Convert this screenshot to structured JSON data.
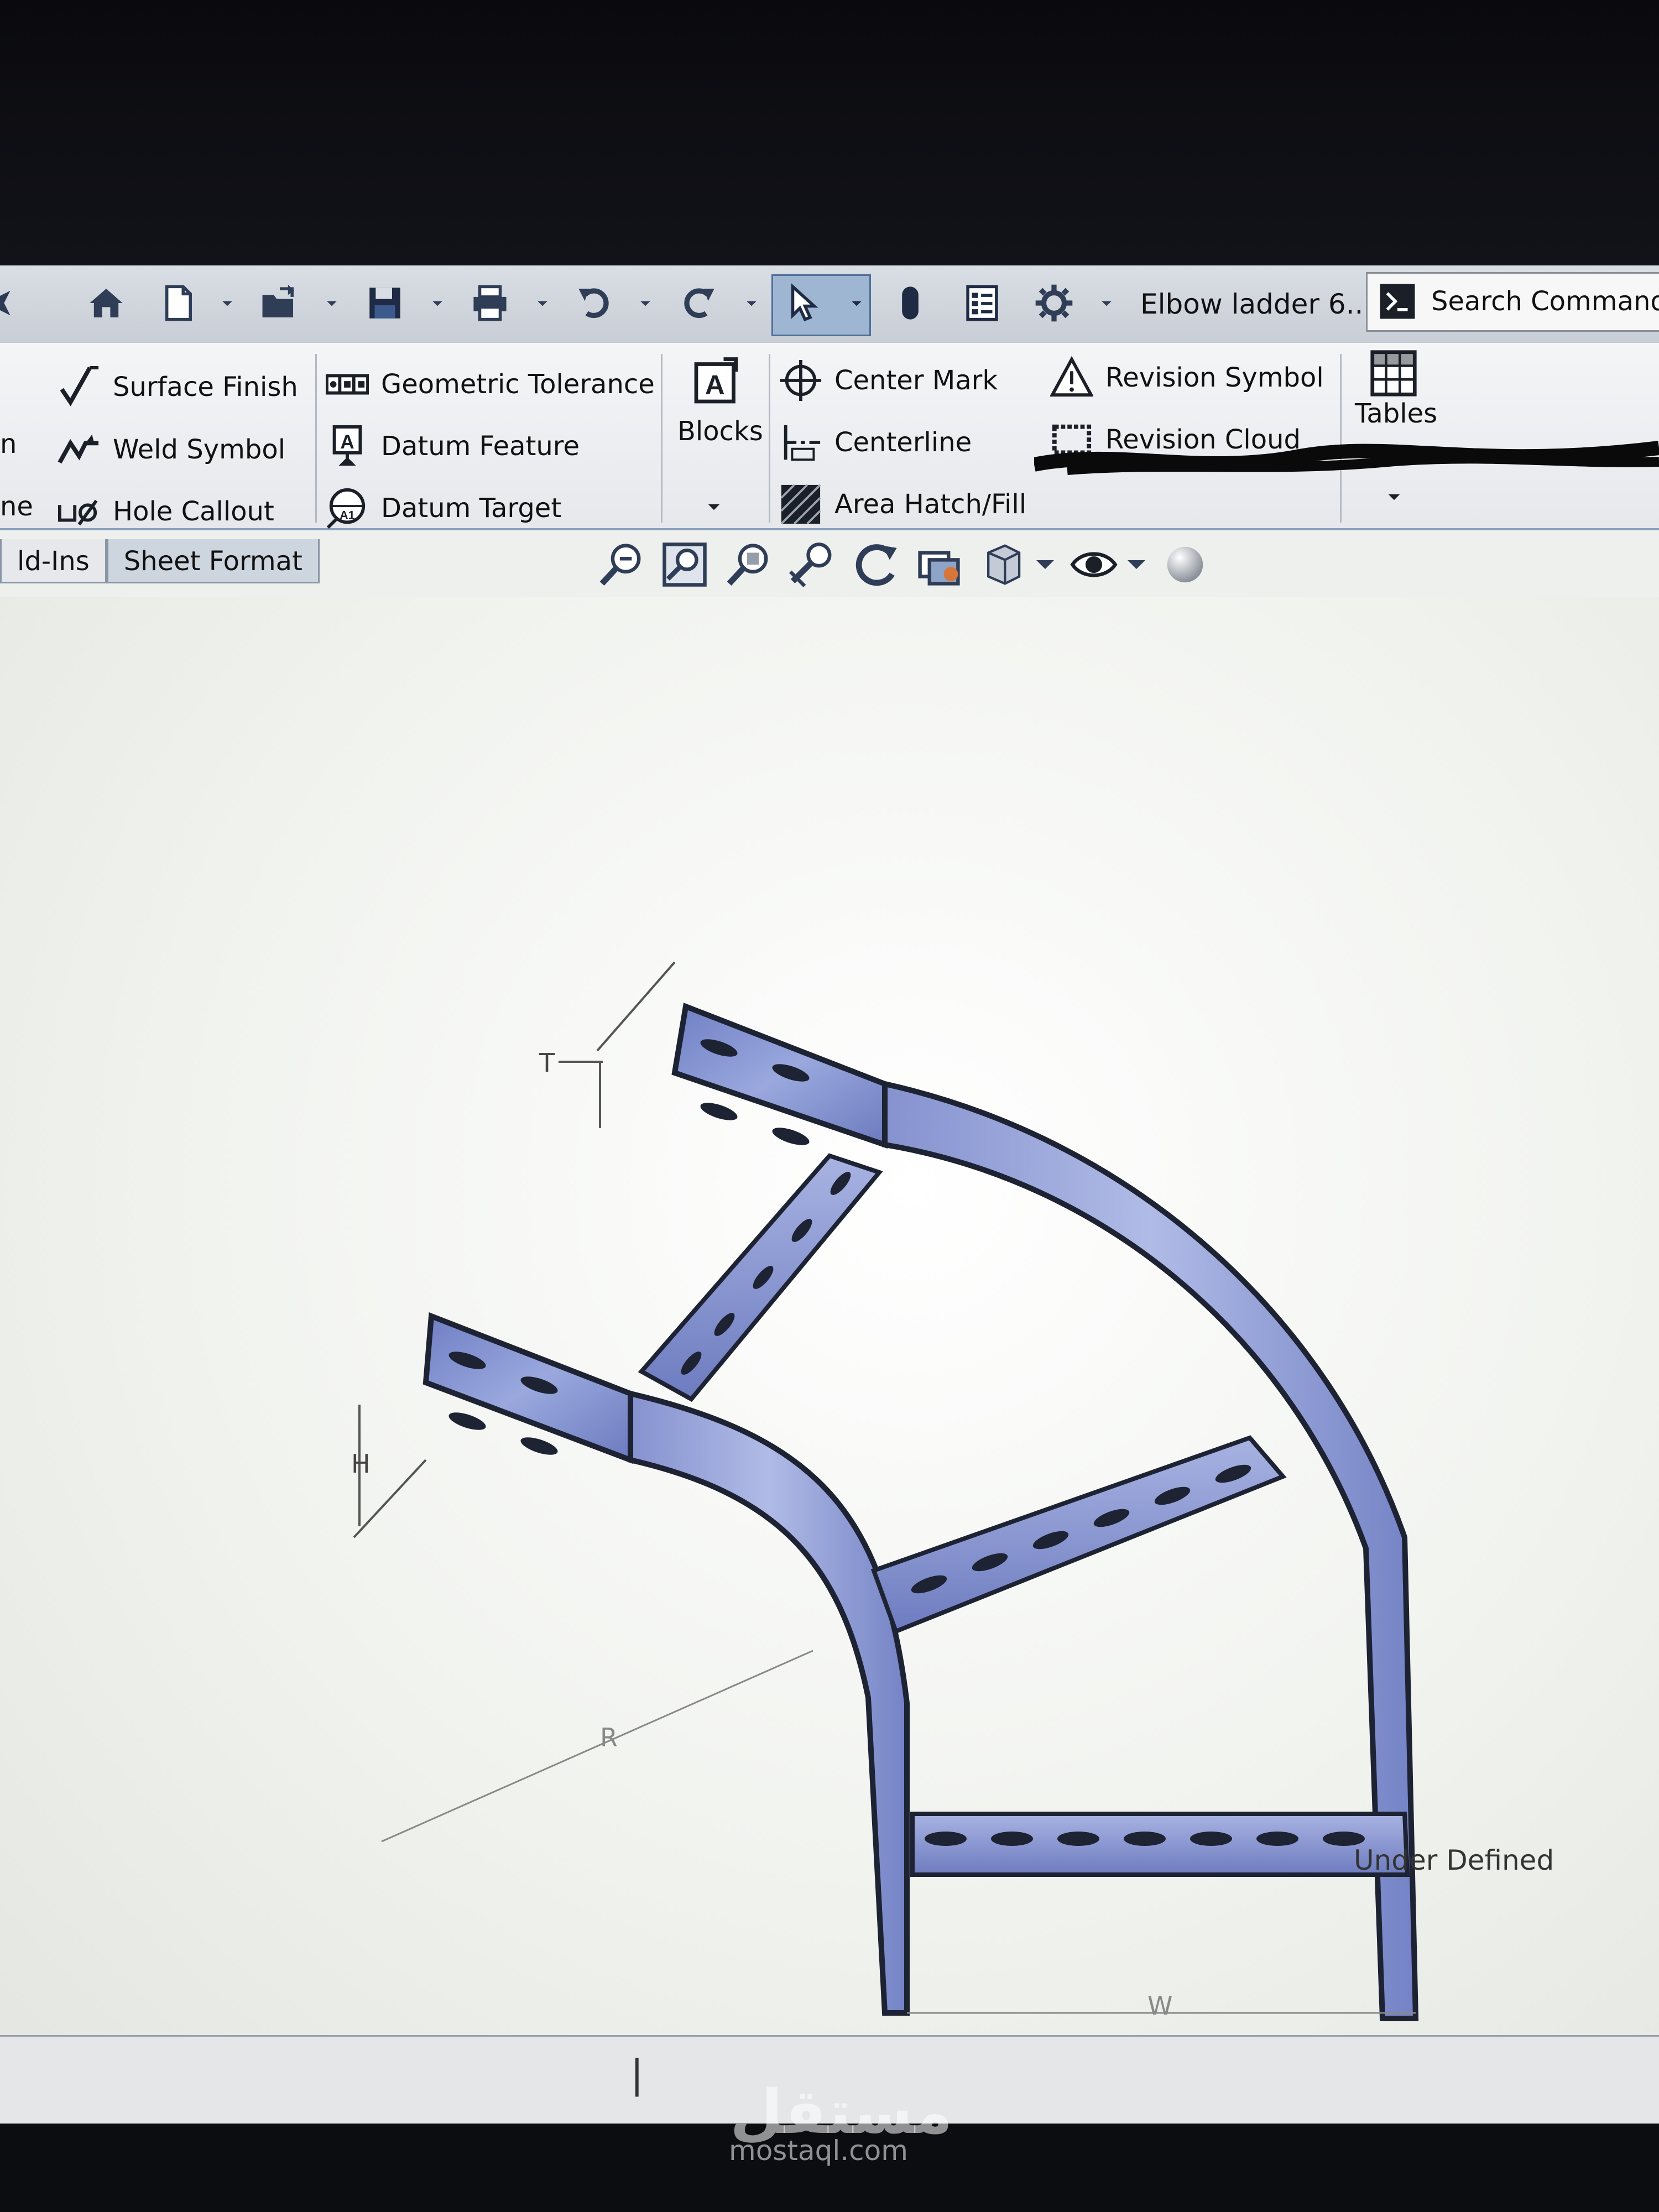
{
  "window": {
    "document_title": "Elbow ladder 6...",
    "search_placeholder": "Search Commands"
  },
  "quick_access": {
    "icons": [
      "home-icon",
      "new-document-icon",
      "open-folder-icon",
      "save-icon",
      "print-icon",
      "undo-icon",
      "redo-icon",
      "select-pointer-icon",
      "rebuild-icon",
      "file-properties-icon",
      "options-gear-icon"
    ]
  },
  "ribbon": {
    "col0": {
      "partial_1": "n",
      "partial_2": "ne"
    },
    "col1": {
      "surface_finish": "Surface Finish",
      "weld_symbol": "Weld Symbol",
      "hole_callout": "Hole Callout"
    },
    "col2": {
      "geometric_tolerance": "Geometric Tolerance",
      "datum_feature": "Datum Feature",
      "datum_target": "Datum Target"
    },
    "col3": {
      "blocks": "Blocks"
    },
    "col4": {
      "center_mark": "Center Mark",
      "centerline": "Centerline",
      "area_hatch": "Area Hatch/Fill"
    },
    "col5": {
      "revision_symbol": "Revision Symbol",
      "revision_cloud": "Revision Cloud"
    },
    "col6": {
      "tables": "Tables"
    }
  },
  "tabs": [
    {
      "label": "ld-Ins"
    },
    {
      "label": "Sheet Format"
    }
  ],
  "drawing": {
    "dim_T": "T",
    "dim_H": "H",
    "dim_R": "R",
    "dim_W": "W"
  },
  "status": {
    "text": "Under Defined"
  },
  "watermark": {
    "arabic": "مستقل",
    "latin": "mostaql.com"
  },
  "colors": {
    "ribbon_bg": "#e8eaee",
    "model_blue": "#7f92d4",
    "model_dark": "#1d2333",
    "selection_blue": "#9fb6d3"
  }
}
